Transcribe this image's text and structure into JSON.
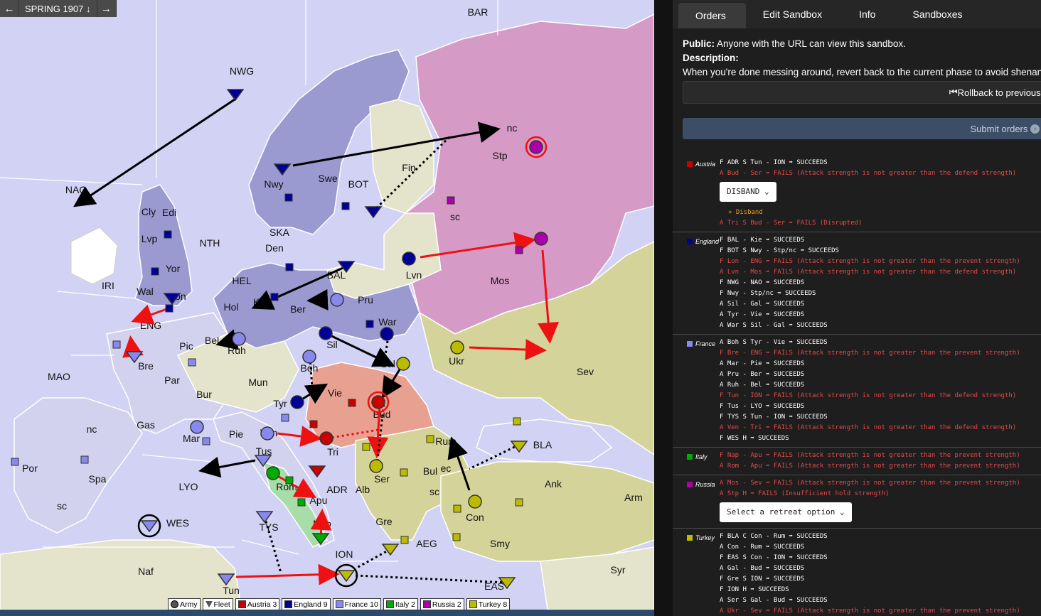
{
  "phase": {
    "label": "SPRING 1907",
    "prev": "←",
    "next": "→",
    "down": "↓"
  },
  "map": {
    "labels": {
      "BAR": "BAR",
      "NWG": "NWG",
      "NAO": "NAO",
      "Stp": "Stp",
      "nc_stp": "nc",
      "sc_stp": "sc",
      "Fin": "Fin",
      "Nwy": "Nwy",
      "Swe": "Swe",
      "BOT": "BOT",
      "Cly": "Cly",
      "Edi": "Edi",
      "Lvp": "Lvp",
      "Yor": "Yor",
      "NTH": "NTH",
      "SKA": "SKA",
      "Den": "Den",
      "IRI": "IRI",
      "Wal": "Wal",
      "Lon": "Lon",
      "HEL": "HEL",
      "BAL": "BAL",
      "Lvn": "Lvn",
      "Mos": "Mos",
      "ENG": "ENG",
      "Hol": "Hol",
      "Kie": "Kie",
      "Ber": "Ber",
      "Pru": "Pru",
      "War": "War",
      "Bel": "Bel",
      "Pic": "Pic",
      "Ruh": "Ruh",
      "Sil": "Sil",
      "Ukr": "Ukr",
      "Bre": "Bre",
      "Par": "Par",
      "Boh": "Boh",
      "Gal": "Gal",
      "Sev": "Sev",
      "MAO": "MAO",
      "Bur": "Bur",
      "Mun": "Mun",
      "Vie": "Vie",
      "Tyr": "Tyr",
      "Bud": "Bud",
      "nc_spa": "nc",
      "Gas": "Gas",
      "Mar": "Mar",
      "Pie": "Pie",
      "Ven": "Ven",
      "Tri": "Tri",
      "Rum": "Rum",
      "BLA": "BLA",
      "Por": "Por",
      "Spa": "Spa",
      "Tus": "Tus",
      "LYO": "LYO",
      "Rom": "Rom",
      "ADR": "ADR",
      "Ser": "Ser",
      "Bul": "Bul",
      "ec_bul": "ec",
      "sc_bul": "sc",
      "Ank": "Ank",
      "Arm": "Arm",
      "sc_spa": "sc",
      "WES": "WES",
      "Apu": "Apu",
      "Nap": "Nap",
      "TYS": "TYS",
      "Alb": "Alb",
      "Gre": "Gre",
      "AEG": "AEG",
      "Con": "Con",
      "Smy": "Smy",
      "ION": "ION",
      "Naf": "Naf",
      "Tun": "Tun",
      "EAS": "EAS",
      "Syr": "Syr"
    },
    "colors": {
      "austria": "#cc0000",
      "england": "#000099",
      "france": "#8888ee",
      "italy": "#00aa00",
      "russia": "#aa00aa",
      "turkey": "#bbbb00"
    }
  },
  "legend": [
    {
      "label": "Army",
      "shape": "circle"
    },
    {
      "label": "Fleet",
      "shape": "triangle"
    },
    {
      "label": "Austria 3",
      "color": "#cc0000"
    },
    {
      "label": "England 9",
      "color": "#000099"
    },
    {
      "label": "France 10",
      "color": "#8888ee"
    },
    {
      "label": "Italy 2",
      "color": "#00aa00"
    },
    {
      "label": "Russia 2",
      "color": "#aa00aa"
    },
    {
      "label": "Turkey 8",
      "color": "#bbbb00"
    }
  ],
  "tabs": [
    "Orders",
    "Edit Sandbox",
    "Info",
    "Sandboxes"
  ],
  "info": {
    "public_label": "Public:",
    "public_text": " Anyone with the URL can view this sandbox.",
    "description_label": "Description:",
    "description_text": "When you're done messing around, revert back to the current phase to avoid shenanigans"
  },
  "rollback_label": "Rollback to previous se",
  "submit_label": "Submit orders",
  "nations": [
    {
      "name": "Austria",
      "color": "#cc0000",
      "orders": [
        {
          "text": "F ADR S Tun - ION ➡ SUCCEEDS",
          "ok": true
        },
        {
          "text": "A Bud - Ser ➡ FAILS (Attack strength is not greater than the defend strength)",
          "ok": false
        }
      ],
      "select": "DISBAND ⌄",
      "note": "» Disband",
      "orders_after": [
        {
          "text": "A Tri S Bud - Ser ➡ FAILS (Disrupted)",
          "ok": false
        }
      ]
    },
    {
      "name": "England",
      "color": "#000099",
      "orders": [
        {
          "text": "F BAL - Kie ➡ SUCCEEDS",
          "ok": true
        },
        {
          "text": "F BOT S Nwy - Stp/nc ➡ SUCCEEDS",
          "ok": true
        },
        {
          "text": "F Lon - ENG ➡ FAILS (Attack strength is not greater than the prevent strength)",
          "ok": false
        },
        {
          "text": "A Lvn - Mos ➡ FAILS (Attack strength is not greater than the defend strength)",
          "ok": false
        },
        {
          "text": "F NWG - NAO ➡ SUCCEEDS",
          "ok": true
        },
        {
          "text": "F Nwy - Stp/nc ➡ SUCCEEDS",
          "ok": true
        },
        {
          "text": "A Sil - Gal ➡ SUCCEEDS",
          "ok": true
        },
        {
          "text": "A Tyr - Vie ➡ SUCCEEDS",
          "ok": true
        },
        {
          "text": "A War S Sil - Gal ➡ SUCCEEDS",
          "ok": true
        }
      ]
    },
    {
      "name": "France",
      "color": "#8888ee",
      "orders": [
        {
          "text": "A Boh S Tyr - Vie ➡ SUCCEEDS",
          "ok": true
        },
        {
          "text": "F Bre - ENG ➡ FAILS (Attack strength is not greater than the prevent strength)",
          "ok": false
        },
        {
          "text": "A Mar - Pie ➡ SUCCEEDS",
          "ok": true
        },
        {
          "text": "A Pru - Ber ➡ SUCCEEDS",
          "ok": true
        },
        {
          "text": "A Ruh - Bel ➡ SUCCEEDS",
          "ok": true
        },
        {
          "text": "F Tun - ION ➡ FAILS (Attack strength is not greater than the defend strength)",
          "ok": false
        },
        {
          "text": "F Tus - LYO ➡ SUCCEEDS",
          "ok": true
        },
        {
          "text": "F TYS S Tun - ION ➡ SUCCEEDS",
          "ok": true
        },
        {
          "text": "A Ven - Tri ➡ FAILS (Attack strength is not greater than the defend strength)",
          "ok": false
        },
        {
          "text": "F WES H ➡ SUCCEEDS",
          "ok": true
        }
      ]
    },
    {
      "name": "Italy",
      "color": "#00aa00",
      "orders": [
        {
          "text": "F Nap - Apu ➡ FAILS (Attack strength is not greater than the prevent strength)",
          "ok": false
        },
        {
          "text": "A Rom - Apu ➡ FAILS (Attack strength is not greater than the prevent strength)",
          "ok": false
        }
      ]
    },
    {
      "name": "Russia",
      "color": "#aa00aa",
      "orders": [
        {
          "text": "A Mos - Sev ➡ FAILS (Attack strength is not greater than the prevent strength)",
          "ok": false
        },
        {
          "text": "A Stp H ➡ FAILS (Insufficient hold strength)",
          "ok": false
        }
      ],
      "select": "Select a retreat option ⌄"
    },
    {
      "name": "Turkey",
      "color": "#bbbb00",
      "orders": [
        {
          "text": "F BLA C Con - Rum ➡ SUCCEEDS",
          "ok": true
        },
        {
          "text": "A Con - Rum ➡ SUCCEEDS",
          "ok": true
        },
        {
          "text": "F EAS S Con - ION ➡ SUCCEEDS",
          "ok": true
        },
        {
          "text": "A Gal - Bud ➡ SUCCEEDS",
          "ok": true
        },
        {
          "text": "F Gre S ION ➡ SUCCEEDS",
          "ok": true
        },
        {
          "text": "F ION H ➡ SUCCEEDS",
          "ok": true
        },
        {
          "text": "A Ser S Gal - Bud ➡ SUCCEEDS",
          "ok": true
        },
        {
          "text": "A Ukr - Sev ➡ FAILS (Attack strength is not greater than the prevent strength)",
          "ok": false
        }
      ]
    }
  ]
}
